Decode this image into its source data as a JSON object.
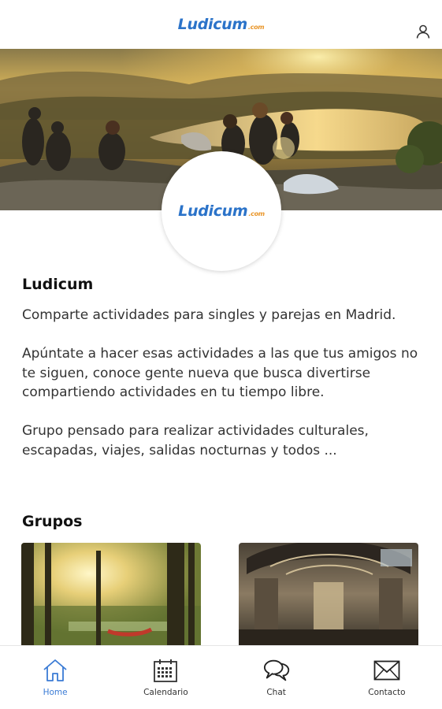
{
  "header": {
    "logo_text": "Ludicum",
    "logo_suffix": ".com",
    "user_icon": "user-icon"
  },
  "profile": {
    "logo_text": "Ludicum",
    "logo_suffix": ".com"
  },
  "group": {
    "title": "Ludicum",
    "description": "Comparte actividades para singles y parejas en Madrid.\n\nApúntate a hacer esas actividades a las que tus amigos no te siguen, conoce gente nueva que busca divertirse compartiendo actividades en tu tiempo libre.\n\nGrupo pensado para realizar actividades culturales, escapadas, viajes, salidas nocturnas y todos ..."
  },
  "groups_section": {
    "title": "Grupos"
  },
  "bottom_nav": {
    "items": [
      {
        "label": "Home",
        "icon": "home-icon",
        "active": true
      },
      {
        "label": "Calendario",
        "icon": "calendar-icon",
        "active": false
      },
      {
        "label": "Chat",
        "icon": "chat-icon",
        "active": false
      },
      {
        "label": "Contacto",
        "icon": "mail-icon",
        "active": false
      }
    ]
  },
  "colors": {
    "brand_blue": "#2b73c9",
    "brand_orange": "#e9962a",
    "active_nav": "#3a7bd5"
  }
}
